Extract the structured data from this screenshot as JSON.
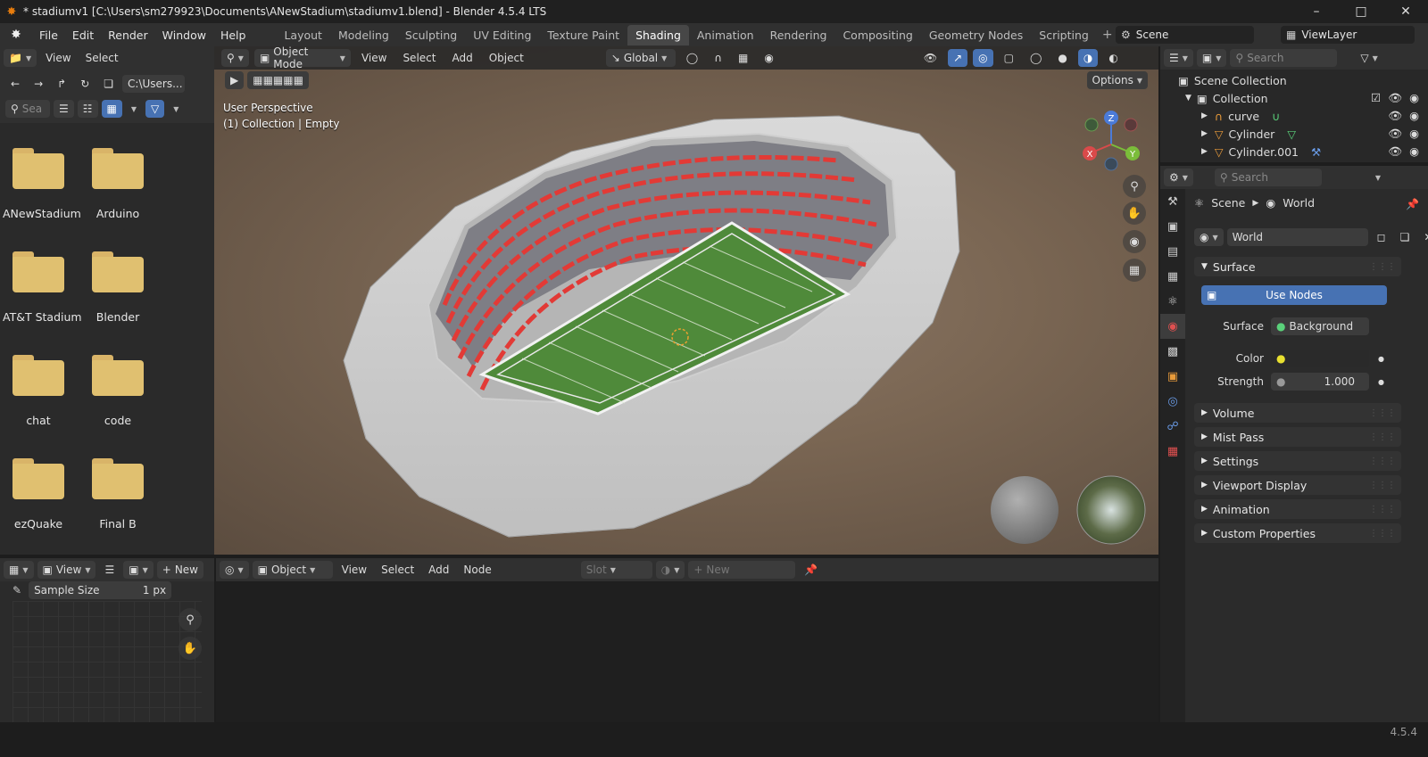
{
  "window": {
    "title": "* stadiumv1 [C:\\Users\\sm279923\\Documents\\ANewStadium\\stadiumv1.blend] - Blender 4.5.4 LTS"
  },
  "menu": {
    "items": [
      "File",
      "Edit",
      "Render",
      "Window",
      "Help"
    ]
  },
  "workspaces": [
    "Layout",
    "Modeling",
    "Sculpting",
    "UV Editing",
    "Texture Paint",
    "Shading",
    "Animation",
    "Rendering",
    "Compositing",
    "Geometry Nodes",
    "Scripting"
  ],
  "active_workspace": "Shading",
  "scene": {
    "name": "Scene",
    "view_layer": "ViewLayer"
  },
  "filebrowser": {
    "menu_view": "View",
    "menu_select": "Select",
    "path": "C:\\Users...",
    "search_placeholder": "Sea",
    "folders": [
      "ANewStadium",
      "Arduino",
      "AT&T Stadium",
      "Blender",
      "chat",
      "code",
      "ezQuake",
      "Final B"
    ]
  },
  "viewport": {
    "mode": "Object Mode",
    "menus": [
      "View",
      "Select",
      "Add",
      "Object"
    ],
    "orientation": "Global",
    "options_label": "Options",
    "info_line1": "User Perspective",
    "info_line2": "(1) Collection | Empty",
    "axis_labels": {
      "x": "X",
      "y": "Y",
      "z": "Z"
    }
  },
  "image_editor": {
    "view_label": "View",
    "new_label": "New",
    "sample_size_label": "Sample Size",
    "sample_size_value": "1 px"
  },
  "shader_editor": {
    "type_label": "Object",
    "menus": [
      "View",
      "Select",
      "Add",
      "Node"
    ],
    "slot_label": "Slot",
    "new_label": "New"
  },
  "outliner": {
    "search_placeholder": "Search",
    "root": "Scene Collection",
    "collection": "Collection",
    "items": [
      "curve",
      "Cylinder",
      "Cylinder.001"
    ]
  },
  "properties": {
    "search_placeholder": "Search",
    "breadcrumb_scene": "Scene",
    "breadcrumb_world": "World",
    "world_name": "World",
    "surface_panel": "Surface",
    "use_nodes_label": "Use Nodes",
    "surface_label": "Surface",
    "surface_value": "Background",
    "color_label": "Color",
    "strength_label": "Strength",
    "strength_value": "1.000",
    "panels": [
      "Volume",
      "Mist Pass",
      "Settings",
      "Viewport Display",
      "Animation",
      "Custom Properties"
    ]
  },
  "status": {
    "version": "4.5.4"
  },
  "colors": {
    "accent": "#4772b3",
    "field_green": "#4f8a3a",
    "seat_red": "#e23a36",
    "folder": "#e0c070"
  }
}
